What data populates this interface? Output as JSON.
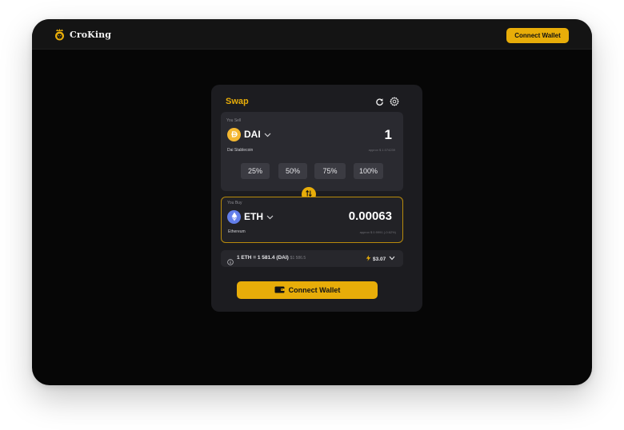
{
  "header": {
    "brand_name": "CroKing",
    "connect_label": "Connect Wallet",
    "logo_icon": "lion-crown-logo-icon"
  },
  "swap": {
    "title": "Swap",
    "refresh_icon": "refresh-icon",
    "settings_icon": "gear-icon",
    "sell": {
      "label": "You Sell",
      "token_symbol": "DAI",
      "token_name": "Dai Stablecoin",
      "amount": "1",
      "approx": "approx $ 1.074239",
      "token_icon": "dai-token-icon"
    },
    "percent_buttons": [
      "25%",
      "50%",
      "75%",
      "100%"
    ],
    "buy": {
      "label": "You Buy",
      "token_symbol": "ETH",
      "token_name": "Ethereum",
      "amount": "0.00063",
      "approx": "approx $ 0.9991 (-0.62%)",
      "token_icon": "ethereum-token-icon"
    },
    "rate": {
      "text": "1 ETH = 1 581.4 (DAI)",
      "usd": "$1 586.5",
      "gas": "$3.07"
    },
    "connect_label": "Connect Wallet"
  },
  "colors": {
    "accent": "#e8ad09",
    "card_bg": "#1c1c20",
    "page_bg": "#060606"
  }
}
